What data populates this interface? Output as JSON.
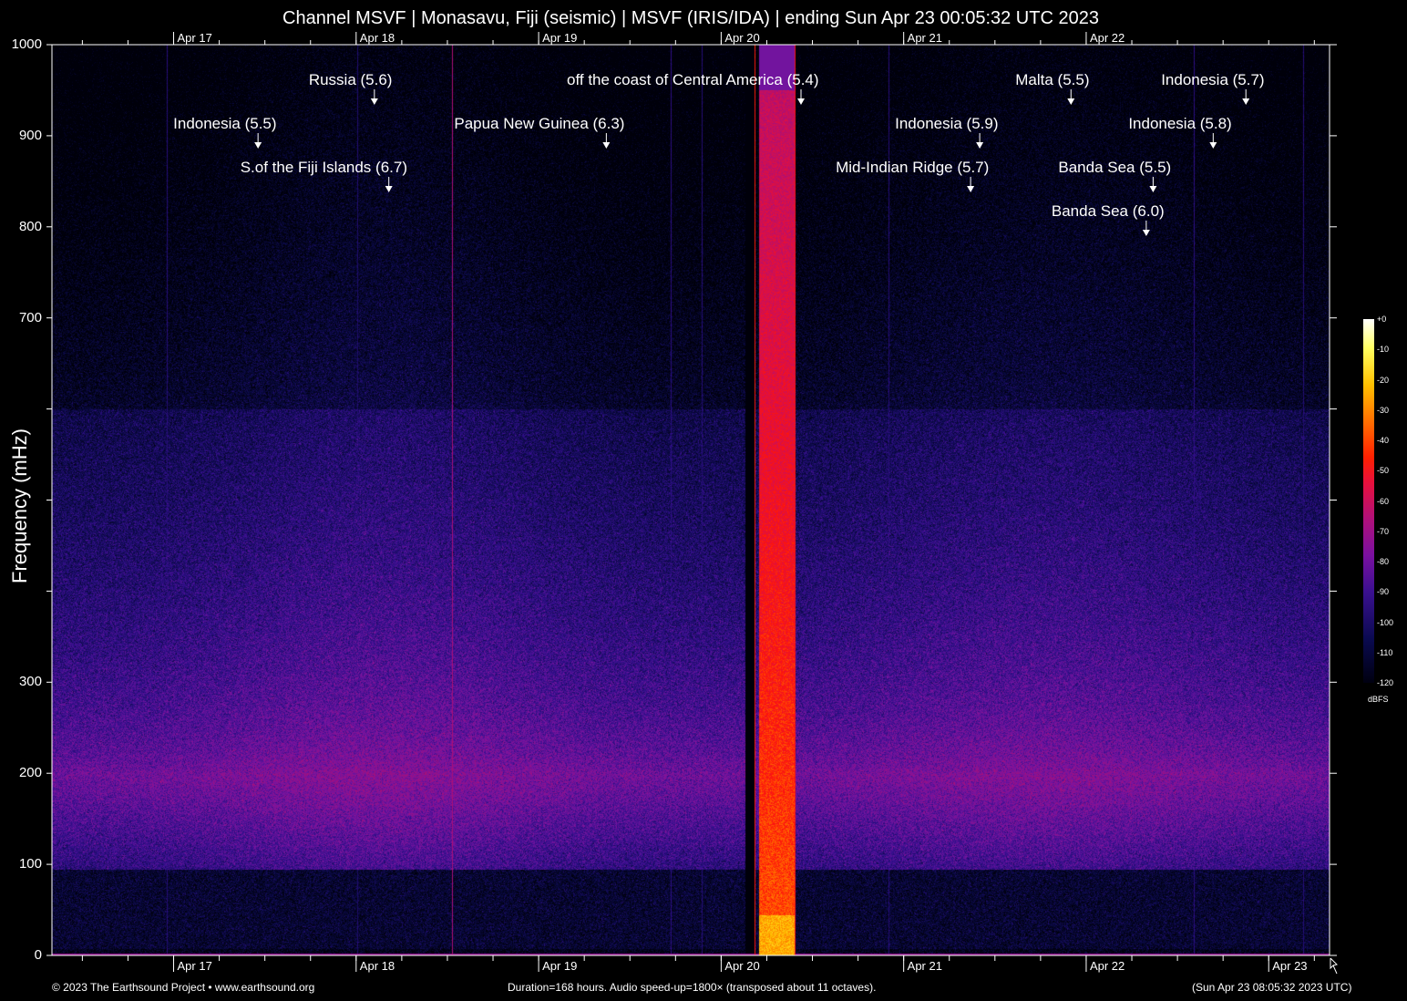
{
  "chart_data": {
    "type": "heatmap",
    "title": "Channel MSVF | Monasavu, Fiji (seismic) | MSVF (IRIS/IDA) | ending Sun Apr 23 00:05:32 UTC 2023",
    "ylabel": "Frequency (mHz)",
    "xlabel": "",
    "ylim": [
      0,
      1000
    ],
    "y_ticks": [
      0,
      100,
      200,
      300,
      400,
      500,
      600,
      700,
      800,
      900,
      1000
    ],
    "y_tick_labels": [
      "0",
      "100",
      "200",
      "300",
      "",
      "",
      "",
      "700",
      "800",
      "900",
      "1000"
    ],
    "x_range_hours": [
      0,
      168
    ],
    "x_tick_labels": [
      {
        "label": "Apr 17",
        "hour": 16
      },
      {
        "label": "Apr 18",
        "hour": 40
      },
      {
        "label": "Apr 19",
        "hour": 64
      },
      {
        "label": "Apr 20",
        "hour": 88
      },
      {
        "label": "Apr 21",
        "hour": 112
      },
      {
        "label": "Apr 22",
        "hour": 136
      },
      {
        "label": "Apr 23",
        "hour": 160
      }
    ],
    "top_x_tick_labels": [
      "Apr 17",
      "Apr 18",
      "Apr 19",
      "Apr 20",
      "Apr 21",
      "Apr 22"
    ],
    "colorbar": {
      "label": "dBFS",
      "range": [
        -120,
        0
      ],
      "ticks": [
        "+0",
        "-10",
        "-20",
        "-30",
        "-40",
        "-50",
        "-60",
        "-70",
        "-80",
        "-90",
        "-100",
        "-110",
        "-120"
      ]
    },
    "events": [
      {
        "label": "Russia (5.6)",
        "hour": 42.4
      },
      {
        "label": "off the coast of Central America (5.4)",
        "hour": 98.5
      },
      {
        "label": "Malta (5.5)",
        "hour": 134.0
      },
      {
        "label": "Indonesia (5.7)",
        "hour": 157.0
      },
      {
        "label": "Indonesia (5.5)",
        "hour": 27.1
      },
      {
        "label": "Papua New Guinea (6.3)",
        "hour": 72.9
      },
      {
        "label": "Indonesia (5.9)",
        "hour": 122.0
      },
      {
        "label": "Indonesia (5.8)",
        "hour": 152.7
      },
      {
        "label": "S.of the Fiji Islands (6.7)",
        "hour": 44.3
      },
      {
        "label": "Mid-Indian Ridge (5.7)",
        "hour": 120.8
      },
      {
        "label": "Banda Sea (5.5)",
        "hour": 144.8
      },
      {
        "label": "Banda Sea (6.0)",
        "hour": 143.9
      }
    ]
  },
  "footer": {
    "copyright": "© 2023 The Earthsound Project • www.earthsound.org",
    "duration": "Duration=168 hours. Audio speed-up=1800× (transposed about 11 octaves).",
    "timestamp": "(Sun Apr 23 08:05:32 2023 UTC)"
  }
}
